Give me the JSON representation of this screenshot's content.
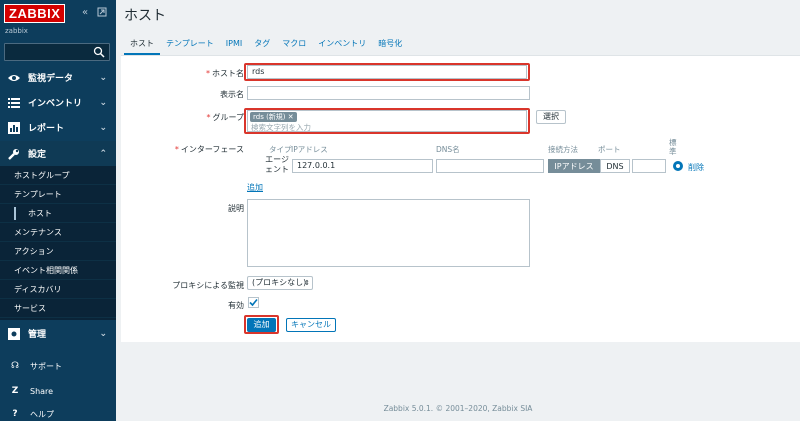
{
  "app": {
    "logo": "ZABBIX",
    "server": "zabbix",
    "footer": "Zabbix 5.0.1. © 2001–2020, Zabbix SIA"
  },
  "sidebar": {
    "menu": [
      {
        "id": "monitoring",
        "label": "監視データ"
      },
      {
        "id": "inventory",
        "label": "インベントリ"
      },
      {
        "id": "reports",
        "label": "レポート"
      },
      {
        "id": "configuration",
        "label": "設定"
      }
    ],
    "submenu": [
      "ホストグループ",
      "テンプレート",
      "ホスト",
      "メンテナンス",
      "アクション",
      "イベント相関関係",
      "ディスカバリ",
      "サービス"
    ],
    "admin": "管理",
    "support": "サポート",
    "share": "Share",
    "help": "ヘルプ"
  },
  "page": {
    "title": "ホスト",
    "tabs": [
      "ホスト",
      "テンプレート",
      "IPMI",
      "タグ",
      "マクロ",
      "インベントリ",
      "暗号化"
    ]
  },
  "form": {
    "host_name_label": "ホスト名",
    "host_name_value": "rds",
    "visible_name_label": "表示名",
    "visible_name_value": "",
    "groups_label": "グループ",
    "group_chip": "rds (新規)",
    "group_search_placeholder": "検索文字列を入力",
    "select_button": "選択",
    "interfaces_label": "インターフェース",
    "iface_headers": {
      "type": "タイプ",
      "ip": "IPアドレス",
      "dns": "DNS名",
      "connect": "接続方法",
      "port": "ポート",
      "default": "標準"
    },
    "iface_type_line1": "エージ",
    "iface_type_line2": "ェント",
    "iface_ip": "127.0.0.1",
    "iface_dns": "",
    "connect_ip": "IPアドレス",
    "connect_dns": "DNS",
    "iface_port": "",
    "remove_link": "削除",
    "add_link": "追加",
    "description_label": "説明",
    "description_value": "",
    "proxy_label": "プロキシによる監視",
    "proxy_value": "(プロキシなし)",
    "enabled_label": "有効",
    "add_button": "追加",
    "cancel_button": "キャンセル"
  },
  "colors": {
    "sidebar": "#0d3d5c",
    "accent": "#0275b8",
    "logo": "#d40000",
    "highlight": "#d9352b"
  }
}
